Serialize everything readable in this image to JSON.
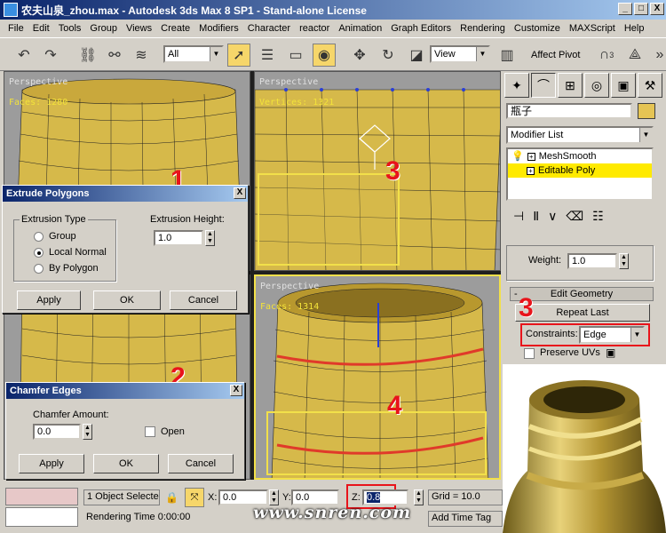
{
  "window": {
    "title": "农夫山泉_zhou.max - Autodesk 3ds Max 8 SP1 - Stand-alone License",
    "min": "_",
    "max": "□",
    "close": "X"
  },
  "menu": [
    "File",
    "Edit",
    "Tools",
    "Group",
    "Views",
    "Create",
    "Modifiers",
    "Character",
    "reactor",
    "Animation",
    "Graph Editors",
    "Rendering",
    "Customize",
    "MAXScript",
    "Help"
  ],
  "toolbar": {
    "selection_filter": "All",
    "ref_coord": "View",
    "affect_pivot": "Affect Pivot",
    "snap_num": "3"
  },
  "viewports": {
    "top_left": {
      "label": "Perspective",
      "stat": "Faces: 1280"
    },
    "top_right": {
      "label": "Perspective",
      "stat": "Vertices: 1321"
    },
    "bottom_right": {
      "label": "Perspective",
      "stat": "Faces: 1314"
    }
  },
  "annotations": {
    "a1": "1",
    "a2": "2",
    "a3_vp": "3",
    "a3_panel": "3",
    "a4": "4"
  },
  "extrude_dialog": {
    "title": "Extrude Polygons",
    "close": "X",
    "group_label": "Extrusion Type",
    "options": [
      "Group",
      "Local Normal",
      "By Polygon"
    ],
    "selected": "Local Normal",
    "height_label": "Extrusion Height:",
    "height_value": "1.0",
    "apply": "Apply",
    "ok": "OK",
    "cancel": "Cancel"
  },
  "chamfer_dialog": {
    "title": "Chamfer Edges",
    "close": "X",
    "amount_label": "Chamfer Amount:",
    "amount_value": "0.0",
    "open_label": "Open",
    "apply": "Apply",
    "ok": "OK",
    "cancel": "Cancel"
  },
  "command_panel": {
    "object_name": "瓶子",
    "modifier_list": "Modifier List",
    "stack": [
      "MeshSmooth",
      "Editable Poly"
    ],
    "selected_stack": "Editable Poly",
    "weight_label": "Weight:",
    "weight_value": "1.0",
    "edit_geometry": "Edit Geometry",
    "repeat_last": "Repeat Last",
    "constraints_label": "Constraints:",
    "constraints_value": "Edge",
    "preserve_uvs": "Preserve UVs",
    "accent": "#ffea00"
  },
  "status": {
    "selection": "1 Object Selecte",
    "x_label": "X:",
    "x_value": "0.0",
    "y_label": "Y:",
    "y_value": "0.0",
    "z_label": "Z:",
    "z_value": "0.8",
    "grid": "Grid = 10.0",
    "rendering_time": "Rendering Time  0:00:00",
    "add_time_tag": "Add Time Tag",
    "watermark": "www.snren.com"
  },
  "colors": {
    "bottle": "#d6b94a",
    "viewport_bg": "#9c9c9c",
    "highlight_red": "#e8141b",
    "active_border": "#f2e04a"
  }
}
